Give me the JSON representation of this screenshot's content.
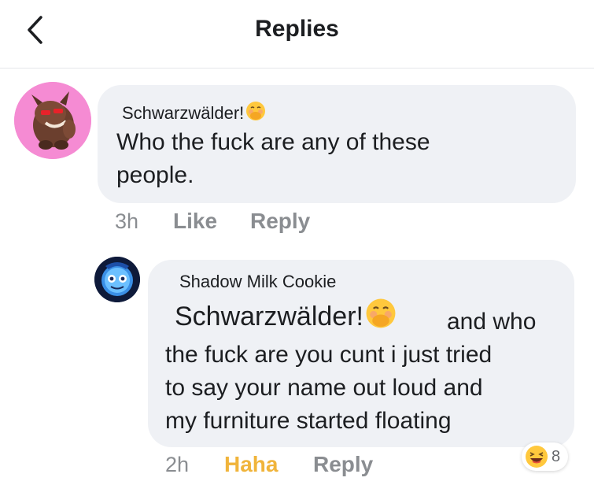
{
  "header": {
    "title": "Replies",
    "back_icon": "chevron-left-icon"
  },
  "comments": [
    {
      "author": "Schwarzwälder!",
      "author_emoji": "blushing-face-with-hand-over-mouth-emoji",
      "text_lines": [
        "Who the fuck are any of these",
        "people."
      ],
      "time": "3h",
      "like_label": "Like",
      "reply_label": "Reply"
    },
    {
      "author": "Shadow Milk Cookie",
      "mention": "Schwarzwälder!",
      "mention_emoji": "blushing-face-with-hand-over-mouth-emoji",
      "text_first": "and who",
      "text_lines": [
        "the fuck are you cunt i just tried",
        "to say your name out loud and",
        "my furniture started floating"
      ],
      "time": "2h",
      "reaction_label": "Haha",
      "reply_label": "Reply",
      "reaction_icon": "laughing-face-emoji",
      "reaction_count": "8"
    }
  ],
  "colors": {
    "bubble": "#eff1f5",
    "meta_text": "#8a8d91",
    "haha": "#f0b43b",
    "avatar1_bg": "#f58bd3",
    "avatar2_bg": "#0e1a3a"
  }
}
